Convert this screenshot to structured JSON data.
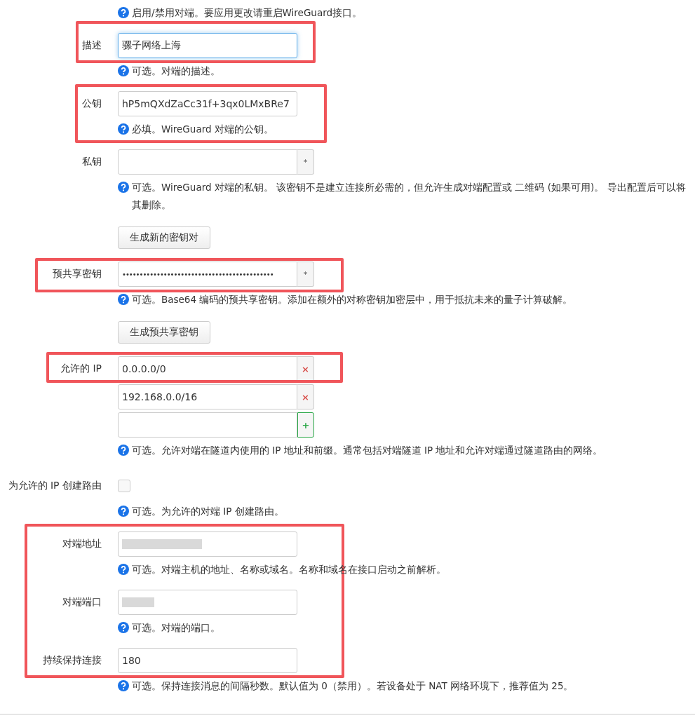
{
  "sections": [
    {
      "highlighted": false,
      "rows": [
        {
          "kind": "help",
          "help": "启用/禁用对端。要应用更改请重启WireGuard接口。"
        }
      ]
    },
    {
      "highlighted": true,
      "rows": [
        {
          "kind": "text",
          "label": "描述",
          "value": "骡子网络上海",
          "focused": true,
          "help": "可选。对端的描述。"
        }
      ]
    },
    {
      "highlighted": true,
      "rows": [
        {
          "kind": "text",
          "label": "公钥",
          "value": "hP5mQXdZaCc31f+3qx0LMxBRe7",
          "focused": false,
          "help": "必填。WireGuard 对端的公钥。"
        }
      ]
    },
    {
      "highlighted": false,
      "rows": [
        {
          "kind": "secret",
          "label": "私钥",
          "value": "",
          "addon": "*",
          "help": "可选。WireGuard 对端的私钥。 该密钥不是建立连接所必需的，但允许生成对端配置或 二维码 (如果可用)。 导出配置后可以将其删除。"
        },
        {
          "kind": "button",
          "text": "生成新的密钥对"
        }
      ]
    },
    {
      "highlighted": true,
      "rows": [
        {
          "kind": "secret",
          "label": "预共享密钥",
          "value": "••••••••••••••••••••••••••••••••••••••••••••",
          "addon": "*",
          "help": "可选。Base64 编码的预共享密钥。添加在额外的对称密钥加密层中，用于抵抗未来的量子计算破解。"
        }
      ]
    },
    {
      "highlighted": false,
      "rows": [
        {
          "kind": "button",
          "text": "生成预共享密钥"
        }
      ]
    },
    {
      "highlighted": true,
      "rows": [
        {
          "kind": "list",
          "label": "允许的 IP",
          "items": [
            {
              "value": "0.0.0.0/0",
              "kind": "remove",
              "symbol": "×"
            },
            {
              "value": "192.168.0.0/16",
              "kind": "remove",
              "symbol": "×"
            },
            {
              "value": "",
              "kind": "add",
              "symbol": "+"
            }
          ],
          "help": "可选。允许对端在隧道内使用的 IP 地址和前缀。通常包括对端隧道 IP 地址和允许对端通过隧道路由的网络。"
        }
      ]
    },
    {
      "highlighted": false,
      "rows": [
        {
          "kind": "checkbox",
          "label": "为允许的 IP 创建路由",
          "checked": false,
          "help": "可选。为允许的对端 IP 创建路由。"
        }
      ]
    },
    {
      "highlighted": true,
      "rows": [
        {
          "kind": "text",
          "label": "对端地址",
          "redacted": true,
          "focused": false,
          "help": "可选。对端主机的地址、名称或域名。名称和域名在接口启动之前解析。"
        },
        {
          "kind": "text",
          "label": "对端端口",
          "redacted": true,
          "focused": false,
          "help": "可选。对端的端口。"
        },
        {
          "kind": "text",
          "label": "持续保持连接",
          "value": "180",
          "focused": false,
          "help": "可选。保持连接消息的间隔秒数。默认值为 0（禁用）。若设备处于 NAT 网络环境下，推荐值为 25。"
        }
      ]
    }
  ]
}
